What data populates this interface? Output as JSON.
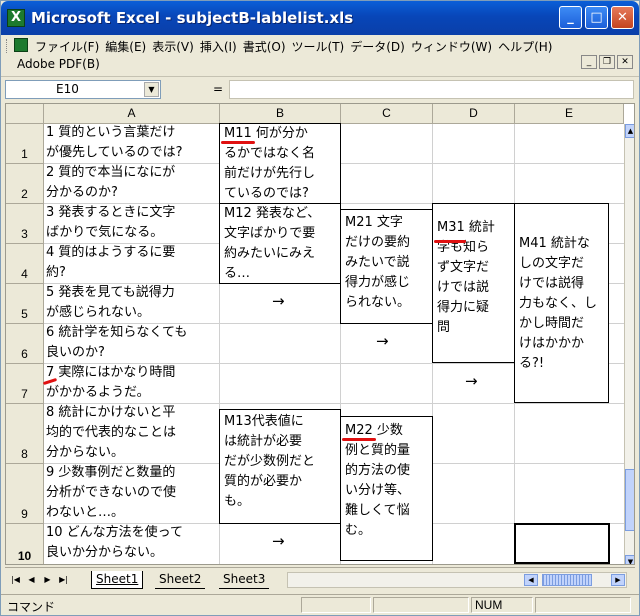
{
  "window": {
    "title": "Microsoft Excel - subjectB-lablelist.xls",
    "app_icon_letter": "X",
    "minimize": "_",
    "maximize": "□",
    "close": "✕"
  },
  "menu": {
    "items": [
      "ファイル(F)",
      "編集(E)",
      "表示(V)",
      "挿入(I)",
      "書式(O)",
      "ツール(T)",
      "データ(D)",
      "ウィンドウ(W)",
      "ヘルプ(H)"
    ],
    "second_row": "Adobe PDF(B)"
  },
  "formula_bar": {
    "name_box": "E10",
    "equals": "=",
    "value": ""
  },
  "columns": [
    "A",
    "B",
    "C",
    "D",
    "E"
  ],
  "rows": [
    "1",
    "2",
    "3",
    "4",
    "5",
    "6",
    "7",
    "8",
    "9",
    "10"
  ],
  "column_a": [
    [
      "1 質的という言葉だけ",
      "が優先しているのでは?"
    ],
    [
      "2 質的で本当になにが",
      "分かるのか?"
    ],
    [
      "3 発表するときに文字",
      "ばかりで気になる。"
    ],
    [
      "4 質的はようするに要",
      "約?"
    ],
    [
      "5 発表を見ても説得力",
      "が感じられない。"
    ],
    [
      "6 統計学を知らなくても",
      "良いのか?"
    ],
    [
      "7 実際にはかなり時間",
      "がかかるようだ。"
    ],
    [
      "8 統計にかけないと平",
      "均的で代表的なことは",
      "分からない。"
    ],
    [
      "9 少数事例だと数量的",
      "分析ができないので使",
      "わないと…。"
    ],
    [
      "10 どんな方法を使って",
      "良いか分からない。"
    ]
  ],
  "boxes": {
    "m11": [
      "M11 何が分か",
      "るかではなく名",
      "前だけが先行し",
      "ているのでは?"
    ],
    "m12": [
      "M12 発表など、",
      "文字ばかりで要",
      "約みたいにみえ",
      "る…"
    ],
    "m13": [
      "M13代表値に",
      "は統計が必要",
      "だが少数例だと",
      "質的が必要か",
      "も。"
    ],
    "m21": [
      "M21 文字",
      "だけの要約",
      "みたいで説",
      "得力が感じ",
      "られない。"
    ],
    "m22": [
      "M22 少数",
      "例と質的量",
      "的方法の使",
      "い分け等、",
      "難しくて悩",
      "む。"
    ],
    "m31": [
      "M31 統計",
      "学も知ら",
      "ず文字だ",
      "けでは説",
      "得力に疑",
      "問"
    ],
    "m41": [
      "M41 統計な",
      "しの文字だ",
      "けでは説得",
      "力もなく、し",
      "かし時間だ",
      "けはかかか",
      "る?!"
    ]
  },
  "arrows": {
    "symbol": "→"
  },
  "sheet_tabs": [
    "Sheet1",
    "Sheet2",
    "Sheet3"
  ],
  "nav_buttons": [
    "|◀",
    "◀",
    "▶",
    "▶|"
  ],
  "status": {
    "mode": "コマンド",
    "num": "NUM"
  }
}
